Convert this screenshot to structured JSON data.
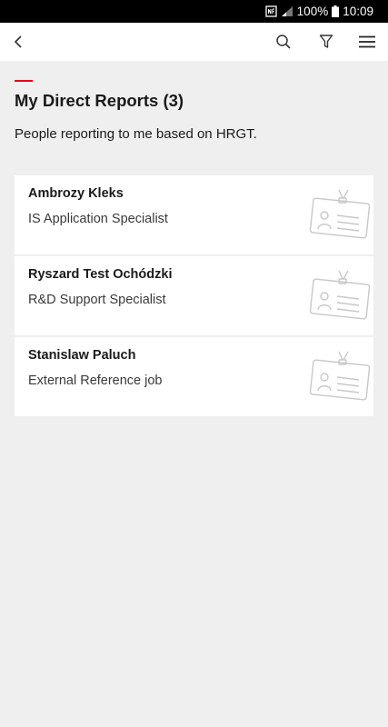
{
  "status_bar": {
    "battery": "100%",
    "time": "10:09"
  },
  "app_bar": {
    "icons": [
      "back-arrow-icon",
      "search-icon",
      "filter-icon",
      "hamburger-menu-icon"
    ]
  },
  "header": {
    "title": "My Direct Reports (3)",
    "subtitle": "People reporting to me based on HRGT."
  },
  "reports": [
    {
      "name": "Ambrozy Kleks",
      "role": "IS Application Specialist",
      "icon": "id-badge-icon"
    },
    {
      "name": "Ryszard Test Ochódzki",
      "role": "R&D Support Specialist",
      "icon": "id-badge-icon"
    },
    {
      "name": "Stanislaw Paluch",
      "role": "External Reference job",
      "icon": "id-badge-icon"
    }
  ],
  "colors": {
    "accent": "#e8001c",
    "background": "#efefef",
    "card": "#ffffff",
    "status_bar": "#000000"
  }
}
